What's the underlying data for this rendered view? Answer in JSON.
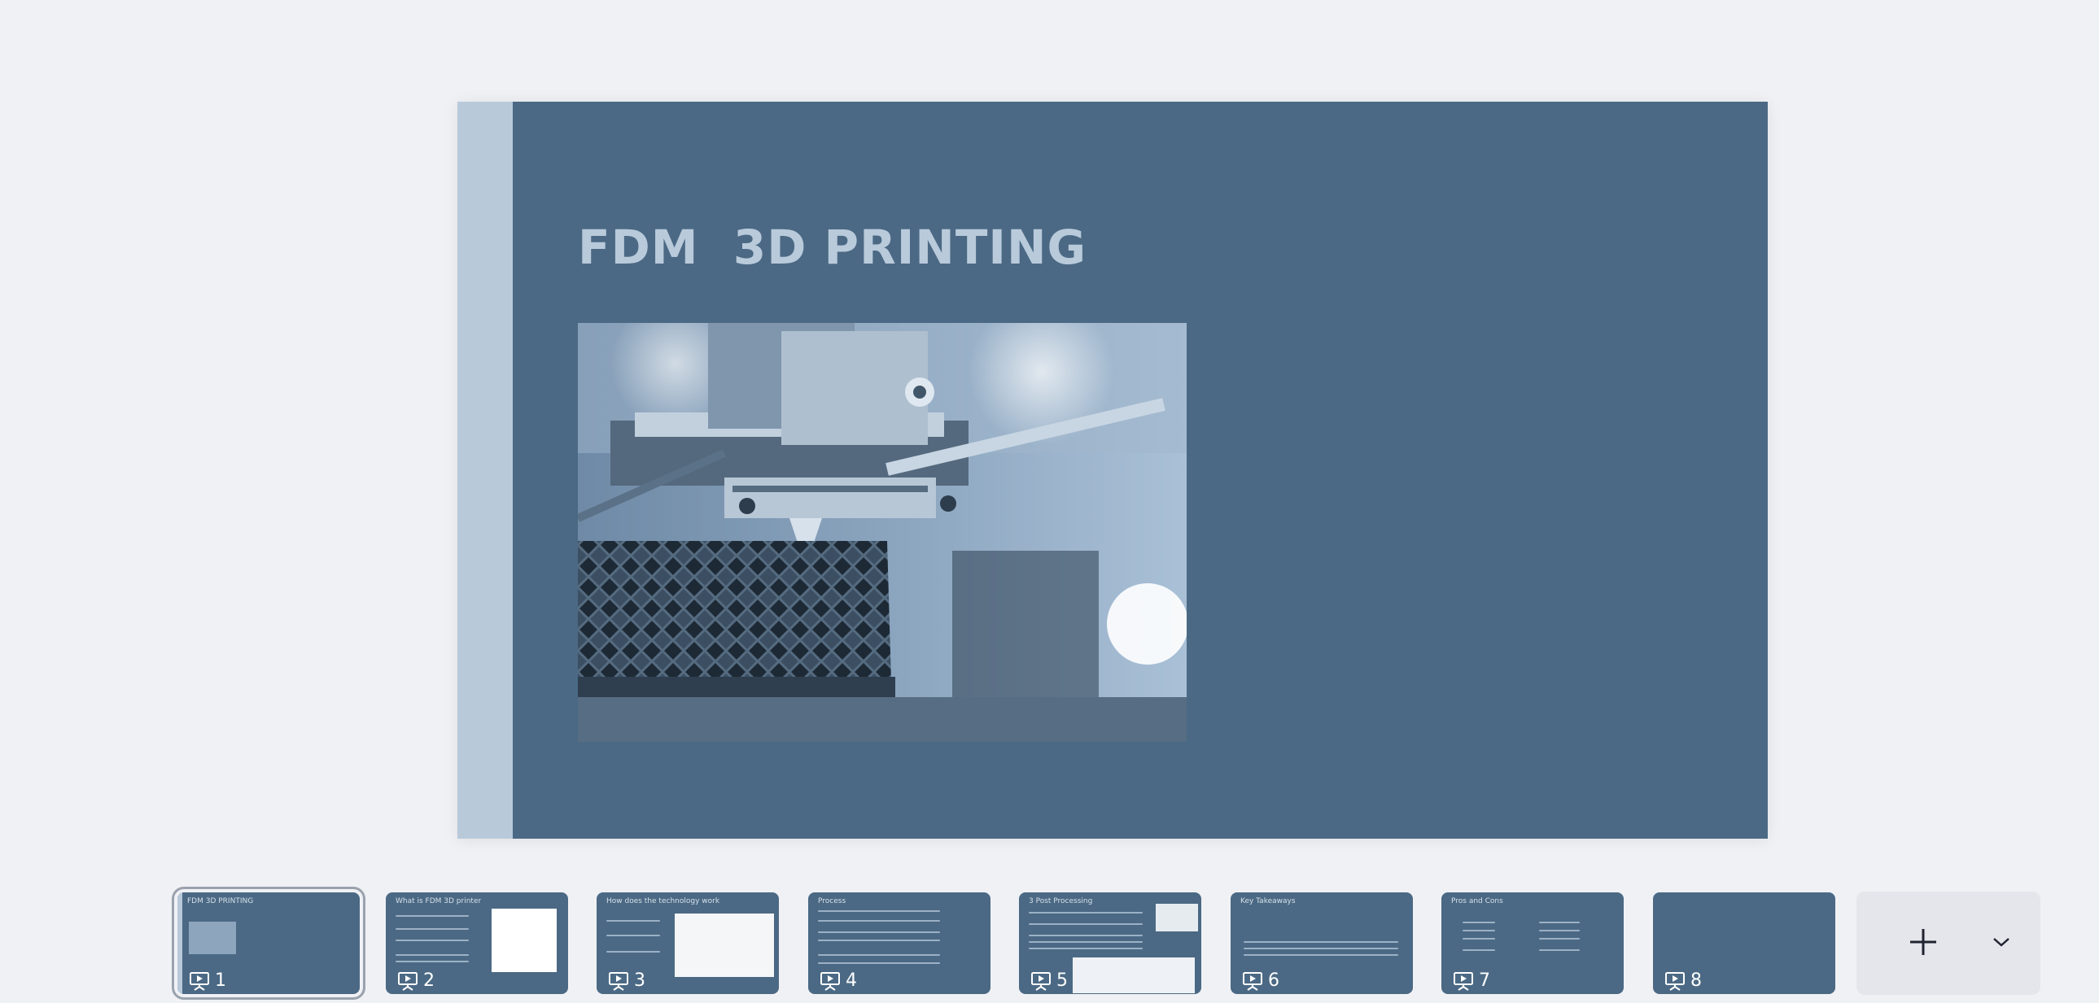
{
  "slide": {
    "title": "FDM  3D PRINTING",
    "image_alt": "3D printer nozzle extruding lattice structure"
  },
  "colors": {
    "slide_bg": "#4b6984",
    "accent_bar": "#b8c9da",
    "title": "#b9cadb",
    "canvas_bg": "#f0f1f5"
  },
  "filmstrip": {
    "thumbnails": [
      {
        "number": "1",
        "title": "FDM  3D PRINTING",
        "selected": true
      },
      {
        "number": "2",
        "title": "What is FDM 3D printer"
      },
      {
        "number": "3",
        "title": "How does the technology work"
      },
      {
        "number": "4",
        "title": "Process"
      },
      {
        "number": "5",
        "title": "3 Post Processing"
      },
      {
        "number": "6",
        "title": "Key Takeaways"
      },
      {
        "number": "7",
        "title": "Pros and Cons"
      },
      {
        "number": "8",
        "title": ""
      }
    ],
    "icons": {
      "slide": "presentation-icon",
      "add": "plus-icon",
      "more": "chevron-down-icon"
    }
  }
}
